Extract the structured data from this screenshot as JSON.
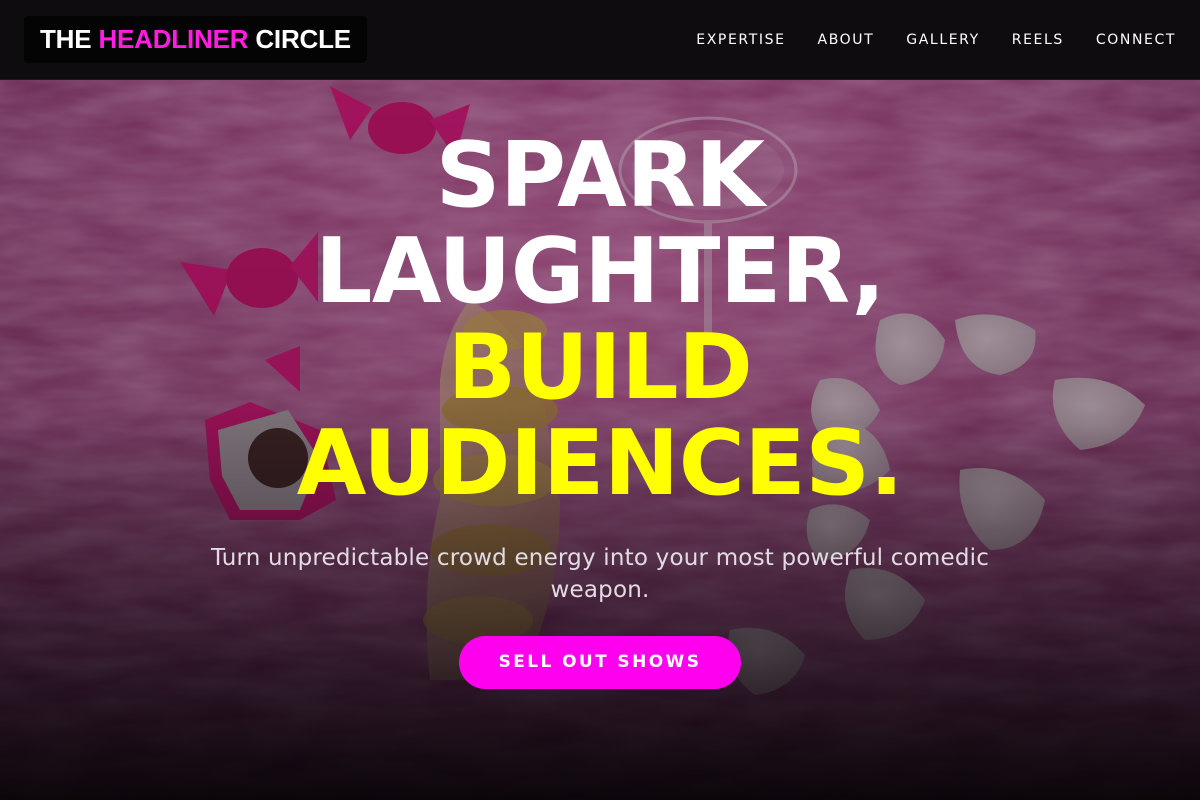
{
  "brand": {
    "part1": "THE",
    "part2": "HEADLINER",
    "part3": "CIRCLE",
    "accent_color": "#ff1ee0"
  },
  "nav": {
    "items": [
      {
        "label": "EXPERTISE"
      },
      {
        "label": "ABOUT"
      },
      {
        "label": "GALLERY"
      },
      {
        "label": "REELS"
      },
      {
        "label": "CONNECT"
      }
    ]
  },
  "hero": {
    "line1": "SPARK",
    "line2": "LAUGHTER,",
    "line3": "BUILD",
    "line4": "AUDIENCES.",
    "subtitle": "Turn unpredictable crowd energy into your most powerful comedic weapon.",
    "cta_label": "SELL OUT SHOWS",
    "highlight_color": "#ffff00",
    "cta_color": "#ff00ee",
    "background_image": "pink-fur-candies-petals-photo"
  }
}
